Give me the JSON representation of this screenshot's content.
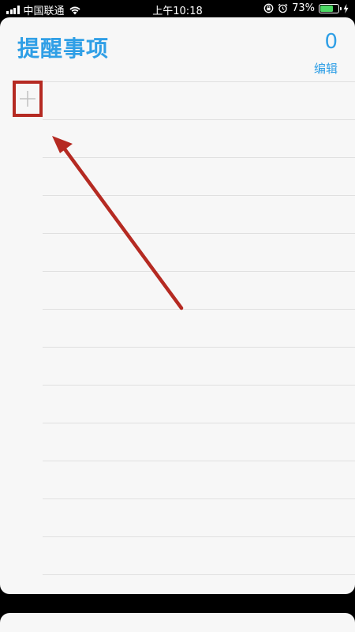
{
  "status_bar": {
    "carrier": "中国联通",
    "time": "上午10:18",
    "battery": "73%",
    "battery_level": 0.73,
    "icons": [
      "signal-icon",
      "wifi-icon",
      "rotation-lock-icon",
      "alarm-icon",
      "battery-icon",
      "charging-icon"
    ]
  },
  "header": {
    "title": "提醒事项",
    "count": "0",
    "edit_label": "编辑"
  },
  "list": {
    "add_icon": "plus-icon"
  },
  "colors": {
    "accent": "#2f9fe6",
    "highlight": "#b52a22",
    "background": "#f7f7f7"
  }
}
